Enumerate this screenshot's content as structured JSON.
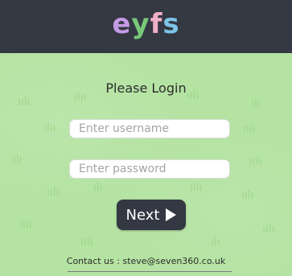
{
  "header": {
    "logo_letters": [
      "e",
      "y",
      "f",
      "s"
    ],
    "logo_colors": [
      "#c49ae6",
      "#78c878",
      "#f2b0c8",
      "#7cc4e6"
    ],
    "background": "#333842"
  },
  "login": {
    "title": "Please Login",
    "username_placeholder": "Enter username",
    "password_placeholder": "Enter password",
    "next_label": "Next",
    "next_icon": "play-icon"
  },
  "footer": {
    "contact_label": "Contact us :",
    "email": "steve@seven360.co.uk"
  },
  "colors": {
    "grass": "#b4e3a2",
    "button": "#333842"
  }
}
